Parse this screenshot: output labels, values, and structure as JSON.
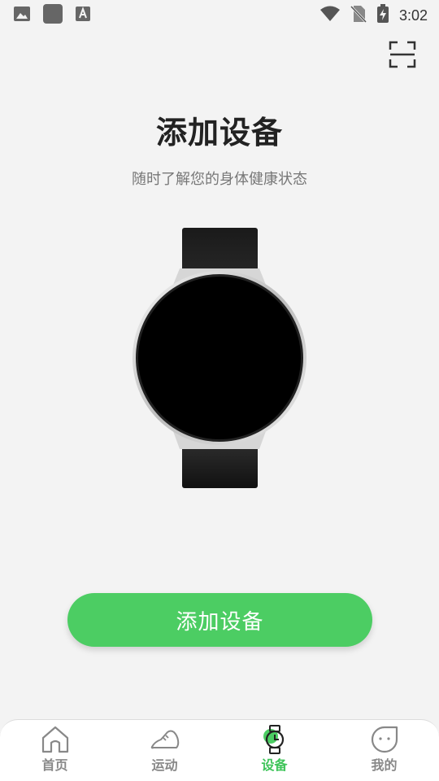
{
  "status_bar": {
    "time": "3:02",
    "left_icons": [
      "image-icon",
      "app-square-icon",
      "text-a-icon"
    ],
    "right_icons": [
      "wifi-icon",
      "no-sim-icon",
      "battery-charging-icon"
    ]
  },
  "header": {
    "scan_icon": "scan-icon"
  },
  "main": {
    "title": "添加设备",
    "subtitle": "随时了解您的身体健康状态",
    "illustration": "smartwatch",
    "add_button_label": "添加设备"
  },
  "bottom_nav": {
    "items": [
      {
        "label": "首页",
        "icon": "home-icon",
        "active": false
      },
      {
        "label": "运动",
        "icon": "shoe-icon",
        "active": false
      },
      {
        "label": "设备",
        "icon": "watch-icon",
        "active": true
      },
      {
        "label": "我的",
        "icon": "face-icon",
        "active": false
      }
    ]
  },
  "colors": {
    "accent": "#4ccd63",
    "active_nav": "#3fc45a",
    "background": "#f3f3f3"
  }
}
